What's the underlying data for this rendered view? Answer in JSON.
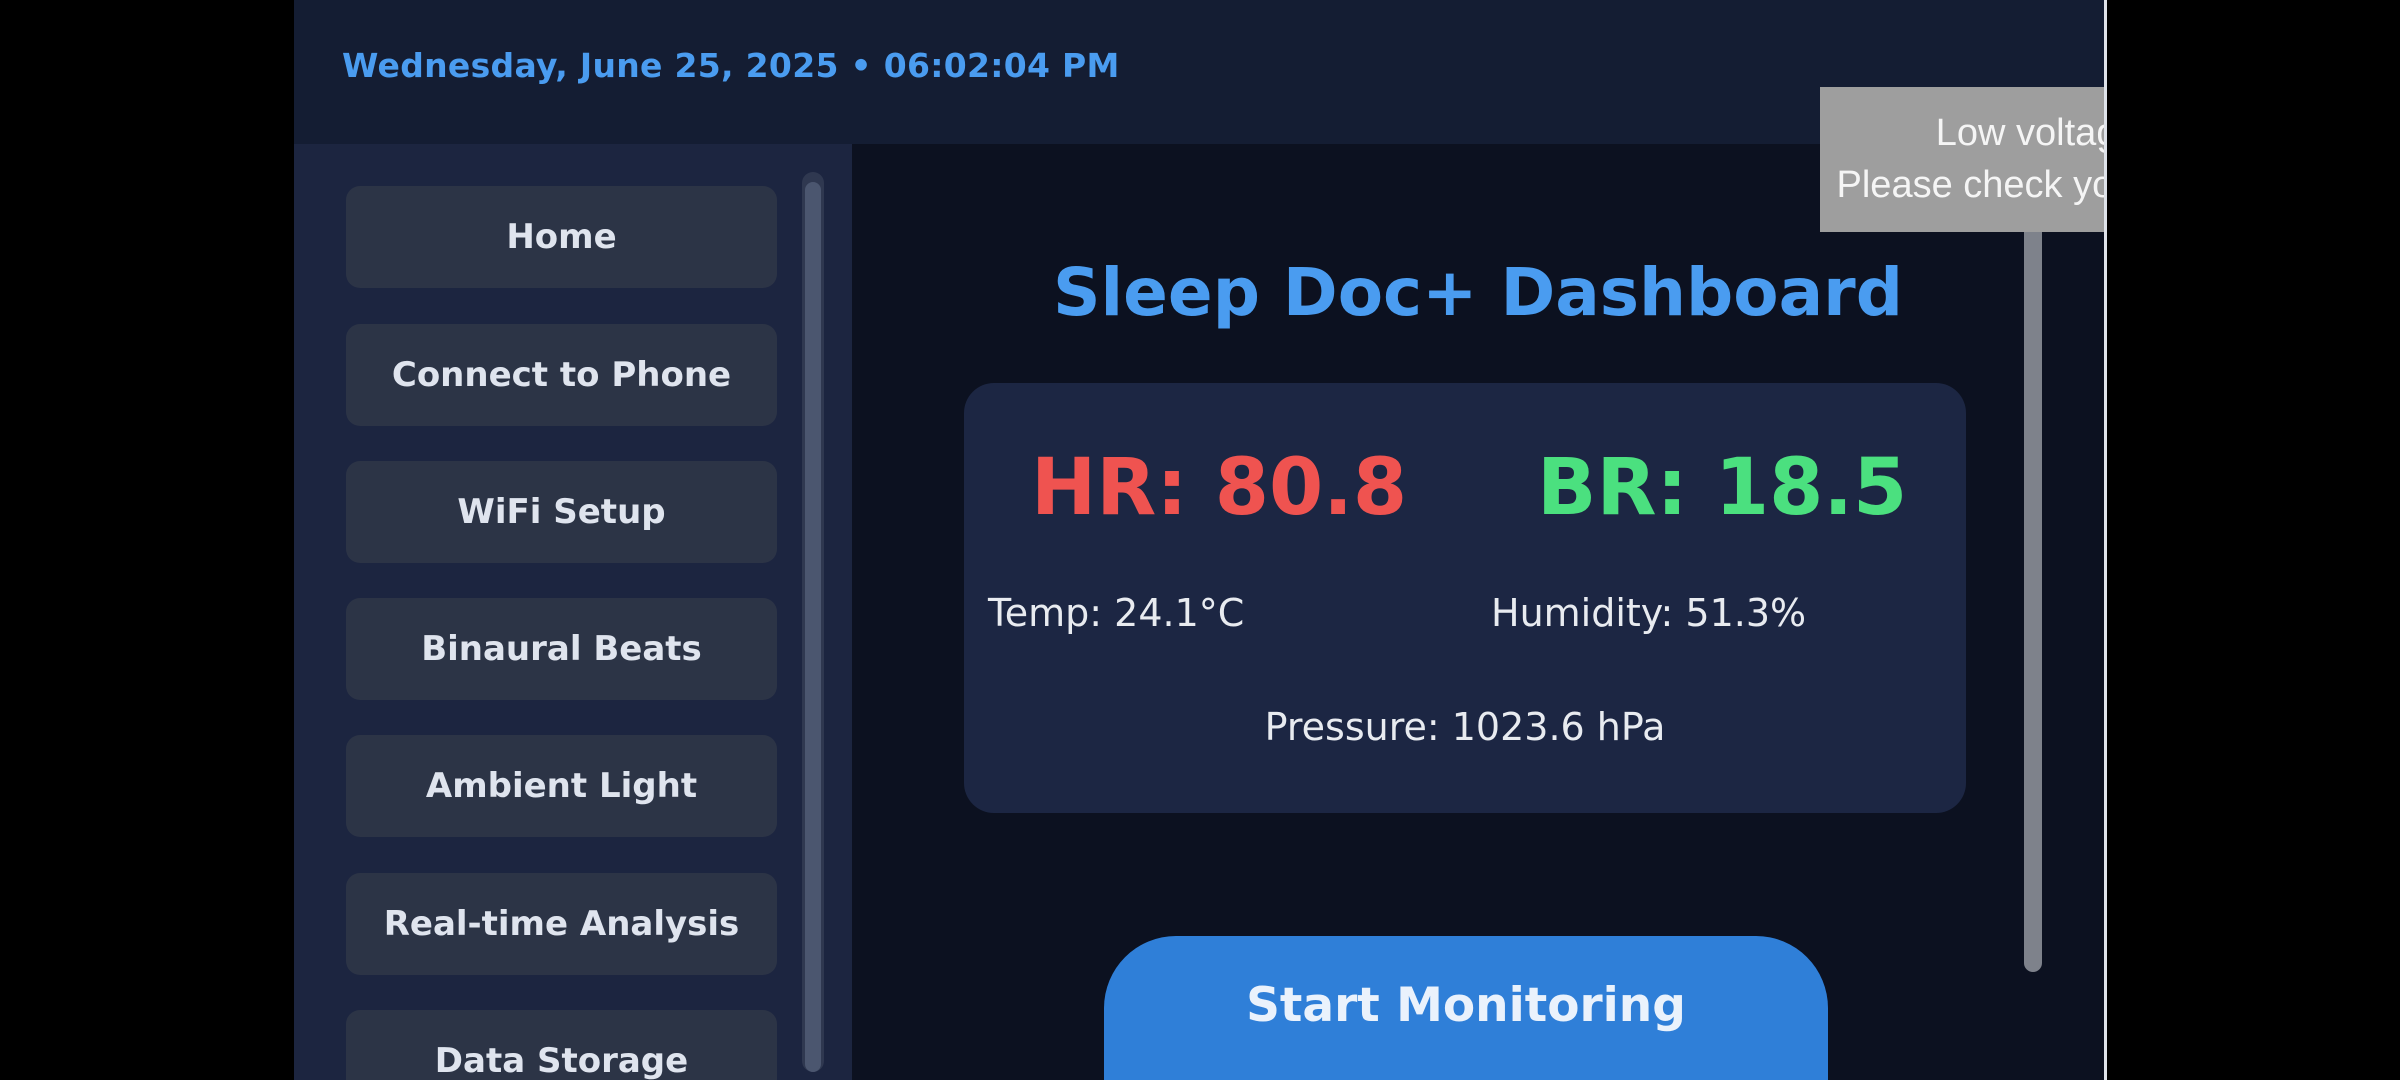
{
  "header": {
    "datetime": "Wednesday, June 25, 2025 • 06:02:04 PM"
  },
  "sidebar": {
    "items": [
      {
        "label": "Home"
      },
      {
        "label": "Connect to Phone"
      },
      {
        "label": "WiFi Setup"
      },
      {
        "label": "Binaural Beats"
      },
      {
        "label": "Ambient Light"
      },
      {
        "label": "Real-time Analysis"
      },
      {
        "label": "Data Storage"
      }
    ]
  },
  "main": {
    "title": "Sleep Doc+ Dashboard",
    "metrics": {
      "hr": "HR: 80.8",
      "br": "BR: 18.5",
      "temp": "Temp: 24.1°C",
      "humidity": "Humidity: 51.3%",
      "pressure": "Pressure: 1023.6 hPa"
    },
    "start_button": "Start Monitoring"
  },
  "notification": {
    "line1": "Low voltage warning",
    "line2": "Please check your power supply"
  },
  "colors": {
    "accent": "#4a9cf0",
    "hr": "#ef5350",
    "br": "#4be07f",
    "button": "#2f7fd8",
    "background": "#0c1120",
    "card": "#1c2643"
  }
}
